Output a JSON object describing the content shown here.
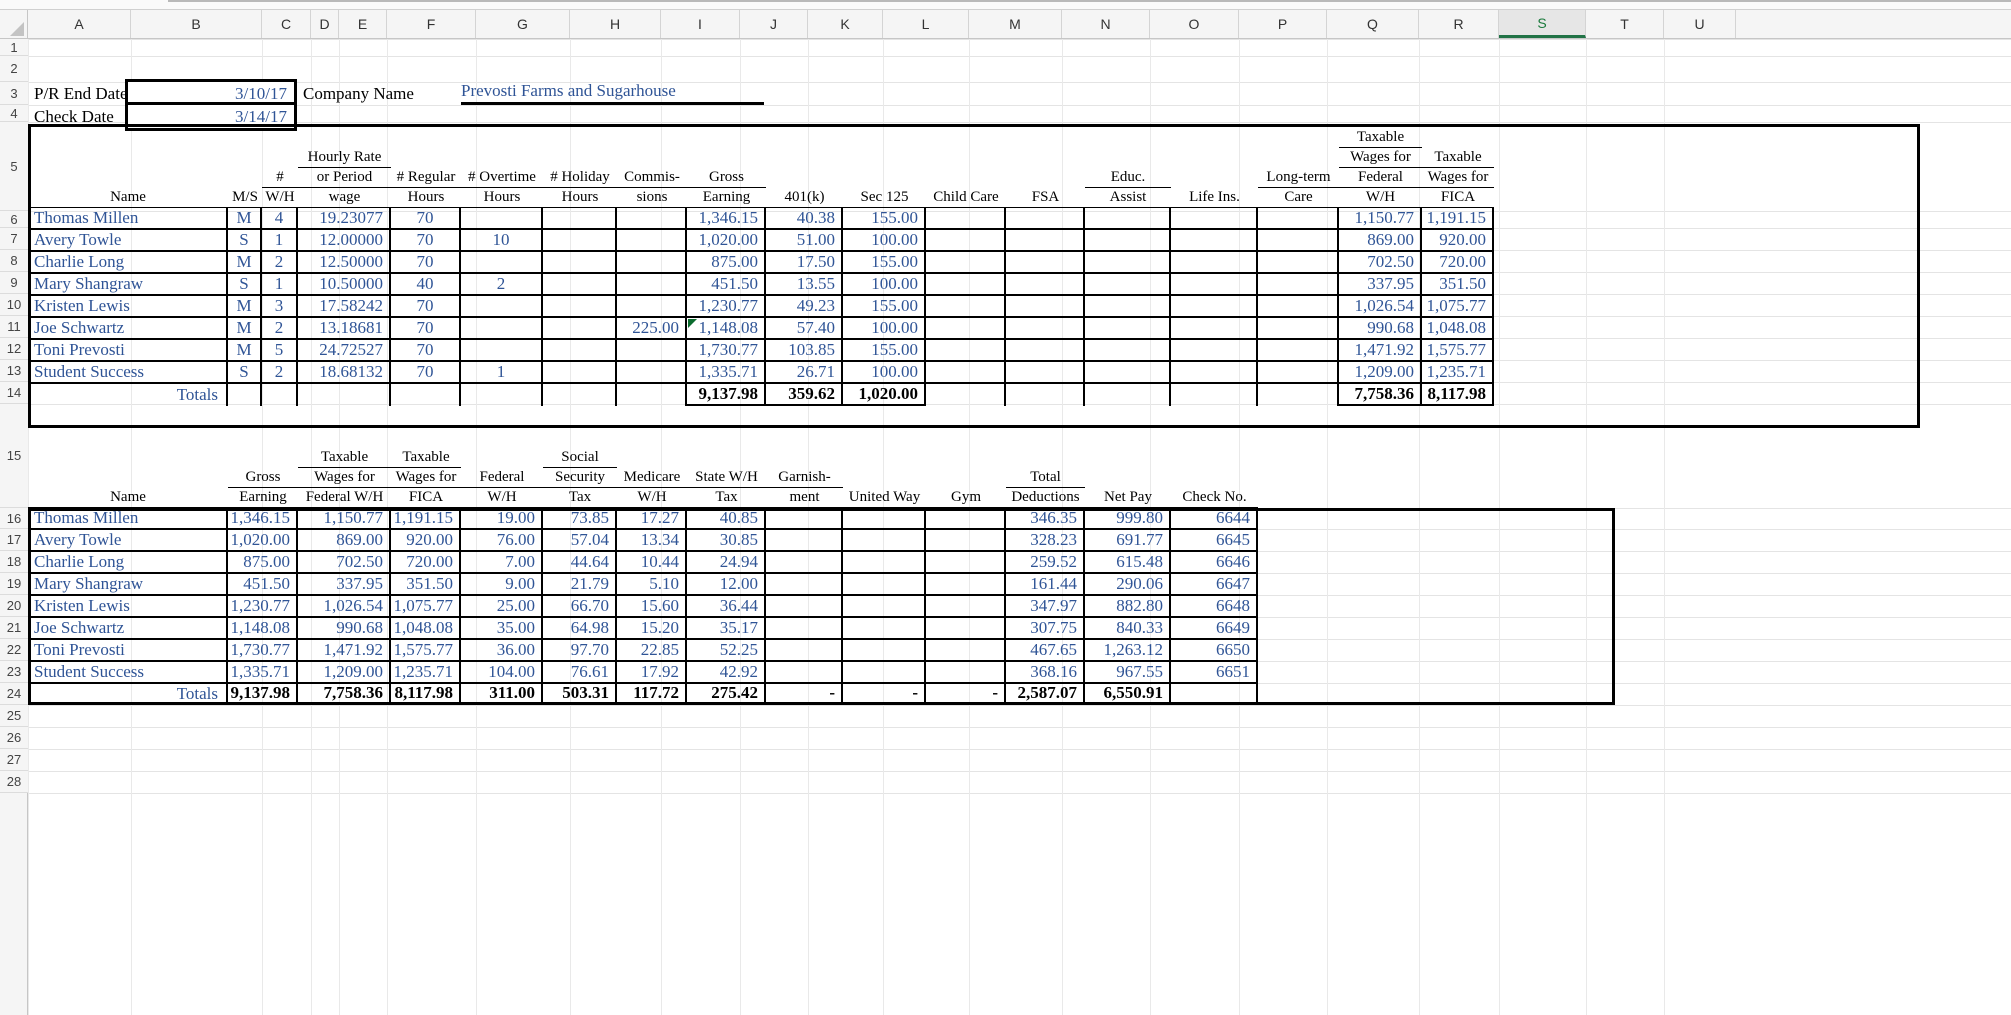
{
  "app": {
    "column_headers": [
      "A",
      "B",
      "C",
      "D",
      "E",
      "F",
      "G",
      "H",
      "I",
      "J",
      "K",
      "L",
      "M",
      "N",
      "O",
      "P",
      "Q",
      "R",
      "S",
      "T",
      "U"
    ],
    "selected_column": "S",
    "row_headers": [
      "1",
      "2",
      "3",
      "4",
      "5",
      "6",
      "7",
      "8",
      "9",
      "10",
      "11",
      "12",
      "13",
      "14",
      "15",
      "16",
      "17",
      "18",
      "19",
      "20",
      "21",
      "22",
      "23",
      "24",
      "25",
      "26",
      "27",
      "28"
    ]
  },
  "form": {
    "pr_end_date_label": "P/R End Date",
    "pr_end_date_value": "3/10/17",
    "check_date_label": "Check Date",
    "check_date_value": "3/14/17",
    "company_name_label": "Company Name",
    "company_name_value": "Prevosti Farms and Sugarhouse"
  },
  "earnings_table": {
    "headers": [
      {
        "lines": [
          "Name"
        ]
      },
      {
        "lines": [
          "M/S"
        ]
      },
      {
        "lines": [
          "#",
          "W/H"
        ]
      },
      {
        "lines": [
          "Hourly Rate",
          "or Period",
          "wage"
        ]
      },
      {
        "lines": [
          "# Regular",
          "Hours"
        ]
      },
      {
        "lines": [
          "# Overtime",
          "Hours"
        ]
      },
      {
        "lines": [
          "# Holiday",
          "Hours"
        ]
      },
      {
        "lines": [
          "Commis-",
          "sions"
        ]
      },
      {
        "lines": [
          "Gross",
          "Earning"
        ]
      },
      {
        "lines": [
          "401(k)"
        ]
      },
      {
        "lines": [
          "Sec 125"
        ]
      },
      {
        "lines": [
          "Child Care"
        ]
      },
      {
        "lines": [
          "FSA"
        ]
      },
      {
        "lines": [
          "Educ.",
          "Assist"
        ]
      },
      {
        "lines": [
          "Life Ins."
        ]
      },
      {
        "lines": [
          "Long-term",
          "Care"
        ]
      },
      {
        "lines": [
          "Taxable",
          "Wages for",
          "Federal",
          "W/H"
        ]
      },
      {
        "lines": [
          "Taxable",
          "Wages for",
          "FICA"
        ]
      }
    ],
    "rows": [
      {
        "name": "Thomas Millen",
        "ms": "M",
        "wh": "4",
        "rate": "19.23077",
        "reg": "70",
        "ot": "",
        "hol": "",
        "comm": "",
        "gross": "1,346.15",
        "k401": "40.38",
        "sec125": "155.00",
        "childcare": "",
        "fsa": "",
        "educ": "",
        "life": "",
        "ltc": "",
        "twfed": "1,150.77",
        "twfica": "1,191.15"
      },
      {
        "name": "Avery Towle",
        "ms": "S",
        "wh": "1",
        "rate": "12.00000",
        "reg": "70",
        "ot": "10",
        "hol": "",
        "comm": "",
        "gross": "1,020.00",
        "k401": "51.00",
        "sec125": "100.00",
        "childcare": "",
        "fsa": "",
        "educ": "",
        "life": "",
        "ltc": "",
        "twfed": "869.00",
        "twfica": "920.00"
      },
      {
        "name": "Charlie Long",
        "ms": "M",
        "wh": "2",
        "rate": "12.50000",
        "reg": "70",
        "ot": "",
        "hol": "",
        "comm": "",
        "gross": "875.00",
        "k401": "17.50",
        "sec125": "155.00",
        "childcare": "",
        "fsa": "",
        "educ": "",
        "life": "",
        "ltc": "",
        "twfed": "702.50",
        "twfica": "720.00"
      },
      {
        "name": "Mary Shangraw",
        "ms": "S",
        "wh": "1",
        "rate": "10.50000",
        "reg": "40",
        "ot": "2",
        "hol": "",
        "comm": "",
        "gross": "451.50",
        "k401": "13.55",
        "sec125": "100.00",
        "childcare": "",
        "fsa": "",
        "educ": "",
        "life": "",
        "ltc": "",
        "twfed": "337.95",
        "twfica": "351.50"
      },
      {
        "name": "Kristen Lewis",
        "ms": "M",
        "wh": "3",
        "rate": "17.58242",
        "reg": "70",
        "ot": "",
        "hol": "",
        "comm": "",
        "gross": "1,230.77",
        "k401": "49.23",
        "sec125": "155.00",
        "childcare": "",
        "fsa": "",
        "educ": "",
        "life": "",
        "ltc": "",
        "twfed": "1,026.54",
        "twfica": "1,075.77"
      },
      {
        "name": "Joe Schwartz",
        "ms": "M",
        "wh": "2",
        "rate": "13.18681",
        "reg": "70",
        "ot": "",
        "hol": "",
        "comm": "225.00",
        "gross": "1,148.08",
        "k401": "57.40",
        "sec125": "100.00",
        "childcare": "",
        "fsa": "",
        "educ": "",
        "life": "",
        "ltc": "",
        "twfed": "990.68",
        "twfica": "1,048.08",
        "has_comment": true
      },
      {
        "name": "Toni Prevosti",
        "ms": "M",
        "wh": "5",
        "rate": "24.72527",
        "reg": "70",
        "ot": "",
        "hol": "",
        "comm": "",
        "gross": "1,730.77",
        "k401": "103.85",
        "sec125": "155.00",
        "childcare": "",
        "fsa": "",
        "educ": "",
        "life": "",
        "ltc": "",
        "twfed": "1,471.92",
        "twfica": "1,575.77"
      },
      {
        "name": "Student Success",
        "ms": "S",
        "wh": "2",
        "rate": "18.68132",
        "reg": "70",
        "ot": "1",
        "hol": "",
        "comm": "",
        "gross": "1,335.71",
        "k401": "26.71",
        "sec125": "100.00",
        "childcare": "",
        "fsa": "",
        "educ": "",
        "life": "",
        "ltc": "",
        "twfed": "1,209.00",
        "twfica": "1,235.71"
      }
    ],
    "totals": {
      "label": "Totals",
      "gross": "9,137.98",
      "k401": "359.62",
      "sec125": "1,020.00",
      "twfed": "7,758.36",
      "twfica": "8,117.98"
    }
  },
  "deductions_table": {
    "headers": [
      {
        "lines": [
          "Name"
        ]
      },
      {
        "lines": [
          "Gross",
          "Earning"
        ]
      },
      {
        "lines": [
          "Taxable",
          "Wages for",
          "Federal W/H"
        ]
      },
      {
        "lines": [
          "Taxable",
          "Wages for",
          "FICA"
        ]
      },
      {
        "lines": [
          "Federal",
          "W/H"
        ]
      },
      {
        "lines": [
          "Social",
          "Security",
          "Tax"
        ]
      },
      {
        "lines": [
          "Medicare",
          "W/H"
        ]
      },
      {
        "lines": [
          "State W/H",
          "Tax"
        ]
      },
      {
        "lines": [
          "Garnish-",
          "ment"
        ]
      },
      {
        "lines": [
          "United Way"
        ]
      },
      {
        "lines": [
          "Gym"
        ]
      },
      {
        "lines": [
          "Total",
          "Deductions"
        ]
      },
      {
        "lines": [
          "Net Pay"
        ]
      },
      {
        "lines": [
          "Check No."
        ]
      }
    ],
    "rows": [
      {
        "name": "Thomas Millen",
        "gross": "1,346.15",
        "twfed": "1,150.77",
        "twfica": "1,191.15",
        "fedwh": "19.00",
        "ss": "73.85",
        "medicare": "17.27",
        "statewh": "40.85",
        "garnish": "",
        "unitedway": "",
        "gym": "",
        "totded": "346.35",
        "netpay": "999.80",
        "checkno": "6644"
      },
      {
        "name": "Avery Towle",
        "gross": "1,020.00",
        "twfed": "869.00",
        "twfica": "920.00",
        "fedwh": "76.00",
        "ss": "57.04",
        "medicare": "13.34",
        "statewh": "30.85",
        "garnish": "",
        "unitedway": "",
        "gym": "",
        "totded": "328.23",
        "netpay": "691.77",
        "checkno": "6645"
      },
      {
        "name": "Charlie Long",
        "gross": "875.00",
        "twfed": "702.50",
        "twfica": "720.00",
        "fedwh": "7.00",
        "ss": "44.64",
        "medicare": "10.44",
        "statewh": "24.94",
        "garnish": "",
        "unitedway": "",
        "gym": "",
        "totded": "259.52",
        "netpay": "615.48",
        "checkno": "6646"
      },
      {
        "name": "Mary Shangraw",
        "gross": "451.50",
        "twfed": "337.95",
        "twfica": "351.50",
        "fedwh": "9.00",
        "ss": "21.79",
        "medicare": "5.10",
        "statewh": "12.00",
        "garnish": "",
        "unitedway": "",
        "gym": "",
        "totded": "161.44",
        "netpay": "290.06",
        "checkno": "6647"
      },
      {
        "name": "Kristen Lewis",
        "gross": "1,230.77",
        "twfed": "1,026.54",
        "twfica": "1,075.77",
        "fedwh": "25.00",
        "ss": "66.70",
        "medicare": "15.60",
        "statewh": "36.44",
        "garnish": "",
        "unitedway": "",
        "gym": "",
        "totded": "347.97",
        "netpay": "882.80",
        "checkno": "6648"
      },
      {
        "name": "Joe Schwartz",
        "gross": "1,148.08",
        "twfed": "990.68",
        "twfica": "1,048.08",
        "fedwh": "35.00",
        "ss": "64.98",
        "medicare": "15.20",
        "statewh": "35.17",
        "garnish": "",
        "unitedway": "",
        "gym": "",
        "totded": "307.75",
        "netpay": "840.33",
        "checkno": "6649"
      },
      {
        "name": "Toni Prevosti",
        "gross": "1,730.77",
        "twfed": "1,471.92",
        "twfica": "1,575.77",
        "fedwh": "36.00",
        "ss": "97.70",
        "medicare": "22.85",
        "statewh": "52.25",
        "garnish": "",
        "unitedway": "",
        "gym": "",
        "totded": "467.65",
        "netpay": "1,263.12",
        "checkno": "6650"
      },
      {
        "name": "Student Success",
        "gross": "1,335.71",
        "twfed": "1,209.00",
        "twfica": "1,235.71",
        "fedwh": "104.00",
        "ss": "76.61",
        "medicare": "17.92",
        "statewh": "42.92",
        "garnish": "",
        "unitedway": "",
        "gym": "",
        "totded": "368.16",
        "netpay": "967.55",
        "checkno": "6651"
      }
    ],
    "totals": {
      "label": "Totals",
      "gross": "9,137.98",
      "twfed": "7,758.36",
      "twfica": "8,117.98",
      "fedwh": "311.00",
      "ss": "503.31",
      "medicare": "117.72",
      "statewh": "275.42",
      "garnish": "-",
      "unitedway": "-",
      "gym": "-",
      "totded": "2,587.07",
      "netpay": "6,550.91"
    }
  },
  "colors": {
    "entry_text": "#2f5496",
    "total_text": "#000000",
    "selected_tab": "#217346",
    "comment_flag": "#0b6b2e"
  }
}
